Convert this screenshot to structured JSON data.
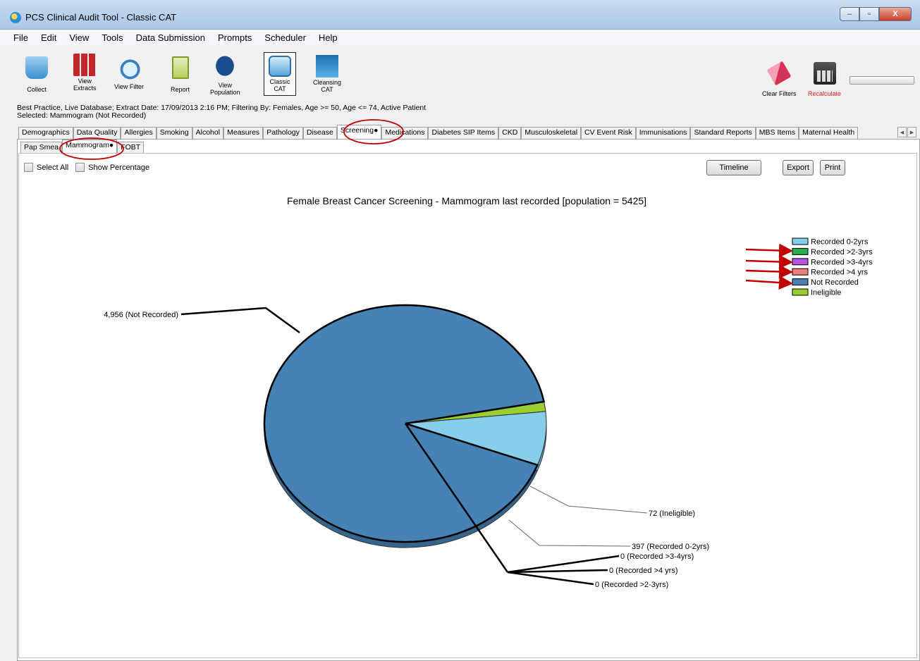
{
  "window": {
    "title": "PCS Clinical Audit Tool - Classic CAT",
    "controls": [
      "–",
      "▫",
      "X"
    ]
  },
  "menu": [
    "File",
    "Edit",
    "View",
    "Tools",
    "Data Submission",
    "Prompts",
    "Scheduler",
    "Help"
  ],
  "toolbar": {
    "collect": "Collect",
    "view_extracts": "View\nExtracts",
    "view_filter": "View Filter",
    "report": "Report",
    "view_population": "View\nPopulation",
    "classic_cat": "Classic\nCAT",
    "cleansing_cat": "Cleansing\nCAT",
    "clear_filters": "Clear Filters",
    "recalculate": "Recalculate"
  },
  "info": {
    "line1": "Best Practice, Live Database; Extract Date: 17/09/2013 2:16 PM; Filtering By: Females, Age >= 50, Age <= 74, Active Patient",
    "line2": "Selected: Mammogram (Not Recorded)"
  },
  "tabs": [
    "Demographics",
    "Data Quality",
    "Allergies",
    "Smoking",
    "Alcohol",
    "Measures",
    "Pathology",
    "Disease",
    "Screening●",
    "Medications",
    "Diabetes SIP Items",
    "CKD",
    "Musculoskeletal",
    "CV Event Risk",
    "Immunisations",
    "Standard Reports",
    "MBS Items",
    "Maternal Health"
  ],
  "tab_scroll": {
    "left": "◀",
    "right": "▶"
  },
  "subtabs": [
    "Pap Smea",
    "Mammogram●",
    "FOBT"
  ],
  "controls": {
    "select_all": "Select All",
    "show_percentage": "Show Percentage",
    "timeline": "Timeline",
    "export": "Export",
    "print": "Print"
  },
  "chart_data": {
    "type": "pie",
    "title": "Female Breast Cancer Screening - Mammogram last recorded [population = 5425]",
    "series": [
      {
        "name": "Recorded 0-2yrs",
        "value": 397,
        "color": "#87ceeb",
        "label": "397 (Recorded 0-2yrs)"
      },
      {
        "name": "Recorded >2-3yrs",
        "value": 0,
        "color": "#22b14c",
        "label": "0 (Recorded >2-3yrs)"
      },
      {
        "name": "Recorded  >3-4yrs",
        "value": 0,
        "color": "#b455e0",
        "label": "0 (Recorded  >3-4yrs)"
      },
      {
        "name": "Recorded >4 yrs",
        "value": 0,
        "color": "#f08080",
        "label": "0 (Recorded >4 yrs)"
      },
      {
        "name": "Not Recorded",
        "value": 4956,
        "color": "#4682b4",
        "label": "4,956 (Not Recorded)"
      },
      {
        "name": "Ineligible",
        "value": 72,
        "color": "#9acd32",
        "label": "72 (Ineligible)"
      }
    ],
    "legend": [
      "Recorded 0-2yrs",
      "Recorded >2-3yrs",
      "Recorded  >3-4yrs",
      "Recorded >4 yrs",
      "Not Recorded",
      "Ineligible"
    ],
    "legend_position": "top-right"
  },
  "annotations": {
    "arrow_color": "#c00000",
    "circle_color": "#c00000"
  }
}
